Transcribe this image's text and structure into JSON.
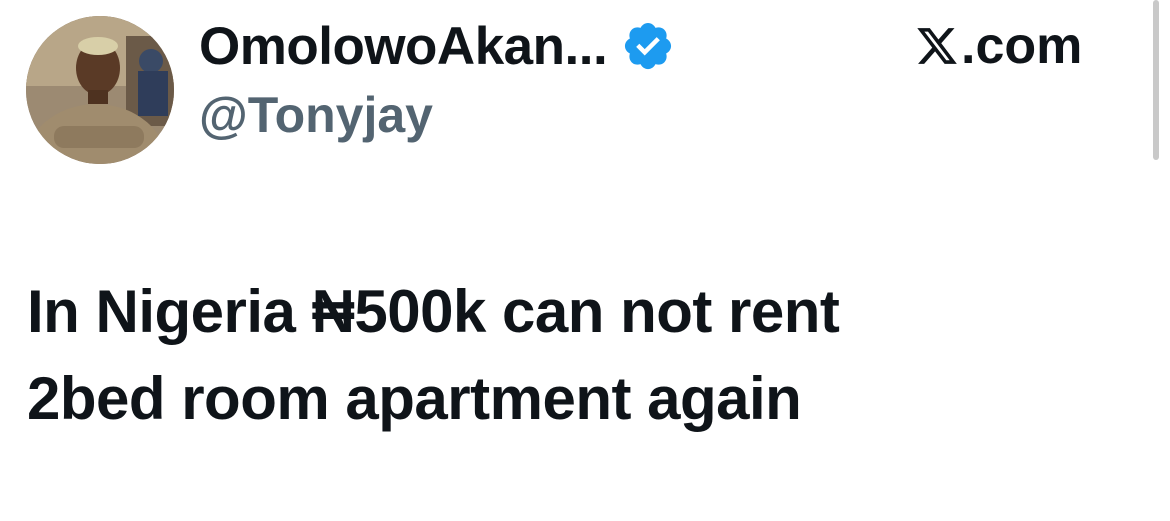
{
  "author": {
    "display_name": "OmolowoAkan...",
    "handle": "@Tonyjay",
    "verified": true,
    "avatar_icon": "user-photo-avatar"
  },
  "source": {
    "label": ".com",
    "icon": "x-logo-icon"
  },
  "tweet": {
    "lines": [
      "In Nigeria ₦500k can not rent",
      "2bed room apartment again"
    ]
  },
  "colors": {
    "text_primary": "#0f1419",
    "text_secondary": "#536471",
    "verified_blue": "#1d9bf0",
    "background": "#ffffff"
  }
}
